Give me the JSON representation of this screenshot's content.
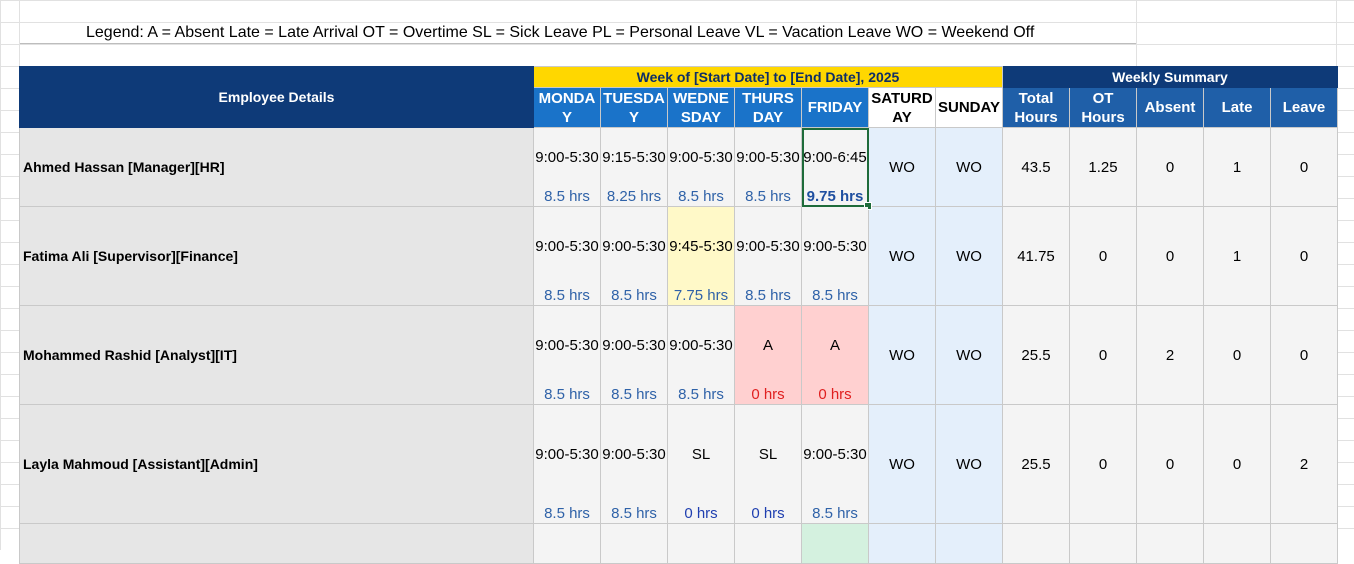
{
  "legend": "Legend: A = Absent Late = Late Arrival OT = Overtime SL = Sick Leave PL = Personal Leave VL = Vacation Leave WO = Weekend Off",
  "headers": {
    "employee_details": "Employee Details",
    "week": "Week of [Start Date] to [End Date], 2025",
    "weekly_summary": "Weekly Summary",
    "days": [
      "MONDA\nY",
      "TUESDA\nY",
      "WEDNE\nSDAY",
      "THURS\nDAY",
      "FRIDAY",
      "SATURD\nAY",
      "SUNDAY"
    ],
    "summary": [
      "Total\nHours",
      "OT\nHours",
      "Absent",
      "Late",
      "Leave"
    ]
  },
  "employees": [
    {
      "name": "Ahmed Hassan [Manager][HR]",
      "days": [
        {
          "time": "9:00-5:30",
          "hours": "8.5 hrs"
        },
        {
          "time": "9:15-5:30",
          "hours": "8.25 hrs"
        },
        {
          "time": "9:00-5:30",
          "hours": "8.5 hrs"
        },
        {
          "time": "9:00-5:30",
          "hours": "8.5 hrs"
        },
        {
          "time": "9:00-6:45",
          "hours": "9.75 hrs"
        }
      ],
      "weekend": [
        "WO",
        "WO"
      ],
      "summary": [
        "43.5",
        "1.25",
        "0",
        "1",
        "0"
      ]
    },
    {
      "name": "Fatima Ali [Supervisor][Finance]",
      "days": [
        {
          "time": "9:00-5:30",
          "hours": "8.5 hrs"
        },
        {
          "time": "9:00-5:30",
          "hours": "8.5 hrs"
        },
        {
          "time": "9:45-5:30",
          "hours": "7.75 hrs"
        },
        {
          "time": "9:00-5:30",
          "hours": "8.5 hrs"
        },
        {
          "time": "9:00-5:30",
          "hours": "8.5 hrs"
        }
      ],
      "weekend": [
        "WO",
        "WO"
      ],
      "summary": [
        "41.75",
        "0",
        "0",
        "1",
        "0"
      ]
    },
    {
      "name": "Mohammed Rashid [Analyst][IT]",
      "days": [
        {
          "time": "9:00-5:30",
          "hours": "8.5 hrs"
        },
        {
          "time": "9:00-5:30",
          "hours": "8.5 hrs"
        },
        {
          "time": "9:00-5:30",
          "hours": "8.5 hrs"
        },
        {
          "time": "A",
          "hours": "0 hrs"
        },
        {
          "time": "A",
          "hours": "0 hrs"
        }
      ],
      "weekend": [
        "WO",
        "WO"
      ],
      "summary": [
        "25.5",
        "0",
        "2",
        "0",
        "0"
      ]
    },
    {
      "name": "Layla Mahmoud [Assistant][Admin]",
      "days": [
        {
          "time": "9:00-5:30",
          "hours": "8.5 hrs"
        },
        {
          "time": "9:00-5:30",
          "hours": "8.5 hrs"
        },
        {
          "time": "SL",
          "hours": "0 hrs"
        },
        {
          "time": "SL",
          "hours": "0 hrs"
        },
        {
          "time": "9:00-5:30",
          "hours": "8.5 hrs"
        }
      ],
      "weekend": [
        "WO",
        "WO"
      ],
      "summary": [
        "25.5",
        "0",
        "0",
        "0",
        "2"
      ]
    }
  ]
}
